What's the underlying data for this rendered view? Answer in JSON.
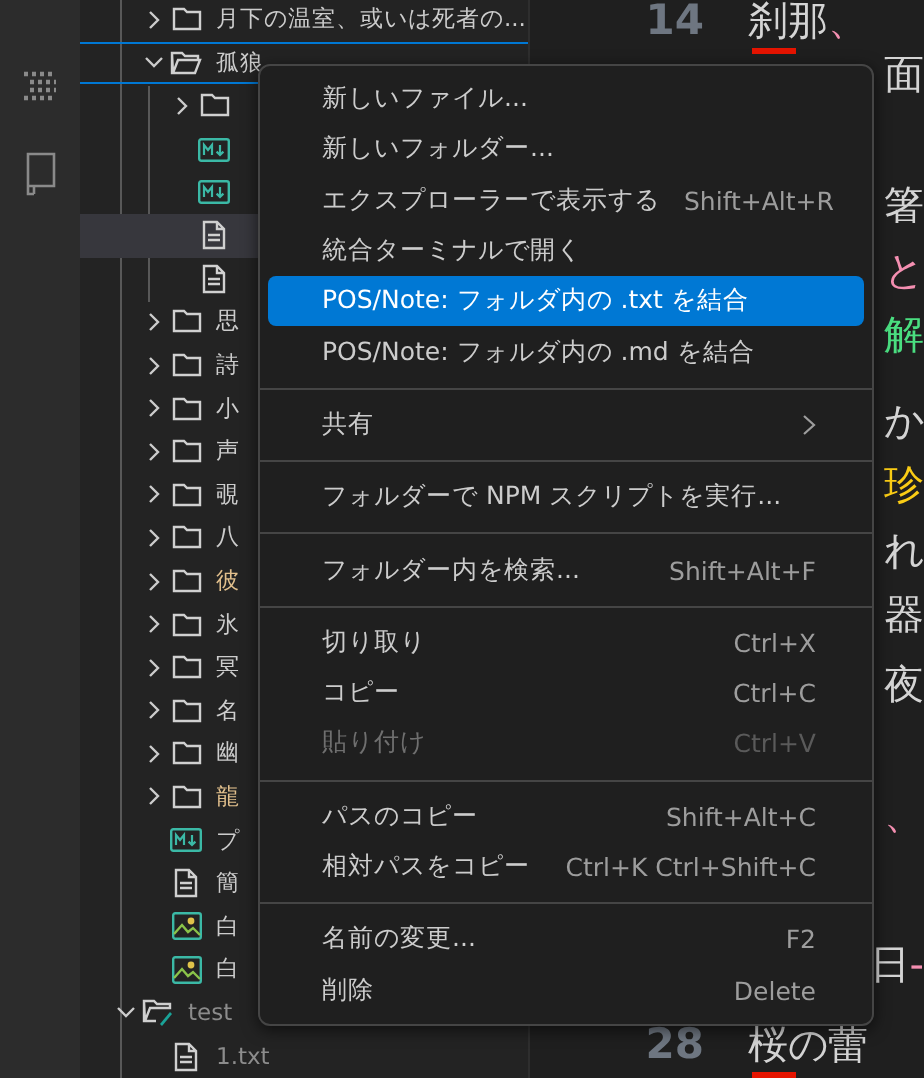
{
  "tree": [
    {
      "children": [
        {
          "name": "月下の温室、或いは死者の...",
          "kind": "folder",
          "expanded": false,
          "selected": false
        },
        {
          "name": "孤狼",
          "kind": "folder",
          "expanded": true,
          "selected": false,
          "drop_target": true,
          "children": [
            {
              "kind": "folder",
              "expanded": false,
              "selected": false
            },
            {
              "kind": "markdown",
              "selected": false
            },
            {
              "kind": "markdown",
              "selected": false
            },
            {
              "kind": "text",
              "selected": true
            },
            {
              "kind": "text",
              "selected": false
            }
          ]
        },
        {
          "name": "思",
          "kind": "folder",
          "expanded": false,
          "selected": false
        },
        {
          "name": "詩",
          "kind": "folder",
          "expanded": false,
          "selected": false
        },
        {
          "name": "小",
          "kind": "folder",
          "expanded": false,
          "selected": false
        },
        {
          "name": "声",
          "kind": "folder",
          "expanded": false,
          "selected": false
        },
        {
          "name": "覗",
          "kind": "folder",
          "expanded": false,
          "selected": false
        },
        {
          "name": "八",
          "kind": "folder",
          "expanded": false,
          "selected": false
        },
        {
          "name": "彼",
          "kind": "folder",
          "expanded": false,
          "selected": false,
          "color": "#e2c08d"
        },
        {
          "name": "氷",
          "kind": "folder",
          "expanded": false,
          "selected": false
        },
        {
          "name": "冥",
          "kind": "folder",
          "expanded": false,
          "selected": false
        },
        {
          "name": "名",
          "kind": "folder",
          "expanded": false,
          "selected": false
        },
        {
          "name": "幽",
          "kind": "folder",
          "expanded": false,
          "selected": false
        },
        {
          "name": "龍",
          "kind": "folder",
          "expanded": false,
          "selected": false,
          "color": "#e2c08d"
        },
        {
          "name": "プ",
          "kind": "markdown",
          "selected": false
        },
        {
          "name": "簡",
          "kind": "text",
          "selected": false
        },
        {
          "name": "白",
          "kind": "image",
          "selected": false
        },
        {
          "name": "白",
          "kind": "image",
          "selected": false
        }
      ]
    },
    {
      "name": "test",
      "kind": "test-folder",
      "expanded": true,
      "selected": false,
      "dimmed": true,
      "children": [
        {
          "name": "1.txt",
          "kind": "text",
          "selected": false,
          "dimmed": true
        }
      ]
    }
  ],
  "editor": [
    {
      "number": "14",
      "marked": true,
      "segments": [
        {
          "text": "刹那"
        },
        {
          "text": "、",
          "color": "#f48fb1"
        }
      ]
    },
    {
      "segments": [
        {
          "text": "面"
        }
      ]
    },
    {
      "segments": [
        {
          "text": "箸"
        }
      ]
    },
    {
      "segments": [
        {
          "text": "と",
          "color": "#f48fb1"
        }
      ]
    },
    {
      "segments": [
        {
          "text": "解",
          "color": "#4ade80"
        }
      ]
    },
    {
      "segments": [
        {
          "text": "か"
        }
      ]
    },
    {
      "segments": [
        {
          "text": "珍",
          "color": "#facc15"
        }
      ]
    },
    {
      "segments": [
        {
          "text": "れ"
        }
      ]
    },
    {
      "segments": [
        {
          "text": "器"
        }
      ]
    },
    {
      "segments": [
        {
          "text": "夜"
        }
      ]
    },
    {
      "segments": [
        {
          "text": "、",
          "color": "#f48fb1"
        }
      ]
    },
    {
      "segments": [
        {
          "text": "日"
        },
        {
          "text": "-",
          "color": "#f48fb1"
        }
      ]
    },
    {
      "number": "28",
      "marked": true,
      "segments": [
        {
          "text": "桜の蕾"
        }
      ]
    }
  ],
  "context_menu": [
    {
      "kind": "item",
      "label": "新しいファイル...",
      "selected": false,
      "disabled": false
    },
    {
      "kind": "item",
      "label": "新しいフォルダー...",
      "selected": false,
      "disabled": false
    },
    {
      "kind": "item",
      "label": "エクスプローラーで表示する",
      "shortcut": "Shift+Alt+R",
      "selected": false,
      "disabled": false
    },
    {
      "kind": "item",
      "label": "統合ターミナルで開く",
      "selected": false,
      "disabled": false
    },
    {
      "kind": "item",
      "label": "POS/Note: フォルダ内の .txt を結合",
      "selected": true,
      "disabled": false
    },
    {
      "kind": "item",
      "label": "POS/Note: フォルダ内の .md を結合",
      "selected": false,
      "disabled": false
    },
    {
      "kind": "separator"
    },
    {
      "kind": "item",
      "label": "共有",
      "submenu": true,
      "selected": false,
      "disabled": false
    },
    {
      "kind": "separator"
    },
    {
      "kind": "item",
      "label": "フォルダーで NPM スクリプトを実行...",
      "selected": false,
      "disabled": false
    },
    {
      "kind": "separator"
    },
    {
      "kind": "item",
      "label": "フォルダー内を検索...",
      "shortcut": "Shift+Alt+F",
      "selected": false,
      "disabled": false
    },
    {
      "kind": "separator"
    },
    {
      "kind": "item",
      "label": "切り取り",
      "shortcut": "Ctrl+X",
      "selected": false,
      "disabled": false
    },
    {
      "kind": "item",
      "label": "コピー",
      "shortcut": "Ctrl+C",
      "selected": false,
      "disabled": false
    },
    {
      "kind": "item",
      "label": "貼り付け",
      "shortcut": "Ctrl+V",
      "selected": false,
      "disabled": true
    },
    {
      "kind": "separator"
    },
    {
      "kind": "item",
      "label": "パスのコピー",
      "shortcut": "Shift+Alt+C",
      "selected": false,
      "disabled": false
    },
    {
      "kind": "item",
      "label": "相対パスをコピー",
      "shortcut": "Ctrl+K Ctrl+Shift+C",
      "selected": false,
      "disabled": false
    },
    {
      "kind": "separator"
    },
    {
      "kind": "item",
      "label": "名前の変更...",
      "shortcut": "F2",
      "selected": false,
      "disabled": false
    },
    {
      "kind": "item",
      "label": "削除",
      "shortcut": "Delete",
      "selected": false,
      "disabled": false
    }
  ]
}
